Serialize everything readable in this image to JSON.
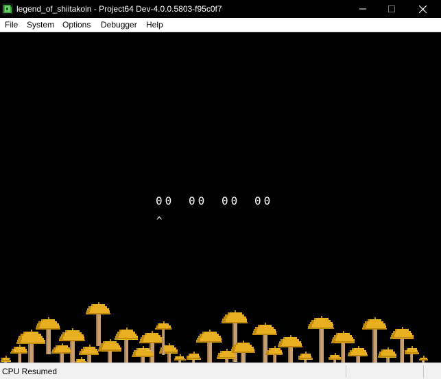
{
  "window": {
    "title": "legend_of_shiitakoin - Project64 Dev-4.0.0.5803-f95c0f7",
    "icon": "project64-icon"
  },
  "menu": {
    "items": [
      {
        "label": "File"
      },
      {
        "label": "System"
      },
      {
        "label": "Options"
      },
      {
        "label": "Debugger"
      },
      {
        "label": "Help"
      }
    ]
  },
  "game": {
    "digit_groups": [
      "00",
      "00",
      "00",
      "00"
    ],
    "cursor": "^",
    "colors": {
      "background": "#000000",
      "text": "#ffffff",
      "mushroom_cap": "#e8b020",
      "mushroom_cap_shade": "#c08a10",
      "mushroom_stem": "#c8a070",
      "mushroom_stem_shade": "#9a7448"
    }
  },
  "status": {
    "text": "CPU Resumed"
  }
}
